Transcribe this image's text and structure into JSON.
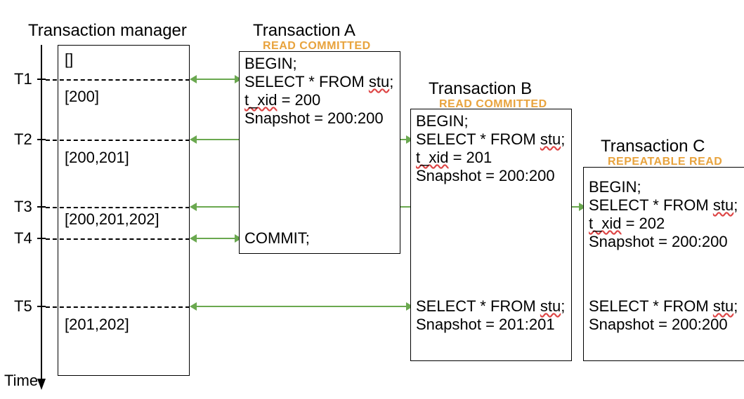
{
  "headers": {
    "tm": "Transaction manager",
    "a": "Transaction A",
    "b": "Transaction B",
    "c": "Transaction C",
    "iso_a": "READ COMMITTED",
    "iso_b": "READ COMMITTED",
    "iso_c": "REPEATABLE READ"
  },
  "time_label": "Time",
  "ticks": [
    "T1",
    "T2",
    "T3",
    "T4",
    "T5"
  ],
  "tm_states": [
    "[]",
    "[200]",
    "[200,201]",
    "[200,201,202]",
    "[201,202]"
  ],
  "tx_a": {
    "l1": "BEGIN;",
    "l2": "SELECT * FROM ",
    "l2u": "stu",
    "l2e": ";",
    "l3a": "t_xid",
    "l3b": " = 200",
    "l4": "Snapshot = 200:200",
    "commit": "COMMIT;"
  },
  "tx_b": {
    "l1": "BEGIN;",
    "l2": "SELECT * FROM ",
    "l2u": "stu",
    "l2e": ";",
    "l3a": "t_xid",
    "l3b": " = 201",
    "l4": "Snapshot = 200:200",
    "s2a": "SELECT * FROM ",
    "s2u": "stu",
    "s2e": ";",
    "s3": "Snapshot = 201:201"
  },
  "tx_c": {
    "l1": "BEGIN;",
    "l2": "SELECT * FROM ",
    "l2u": "stu",
    "l2e": ";",
    "l3a": "t_xid",
    "l3b": " = 202",
    "l4": "Snapshot = 200:200",
    "s2a": "SELECT * FROM ",
    "s2u": "stu",
    "s2e": ";",
    "s3": "Snapshot = 200:200"
  }
}
